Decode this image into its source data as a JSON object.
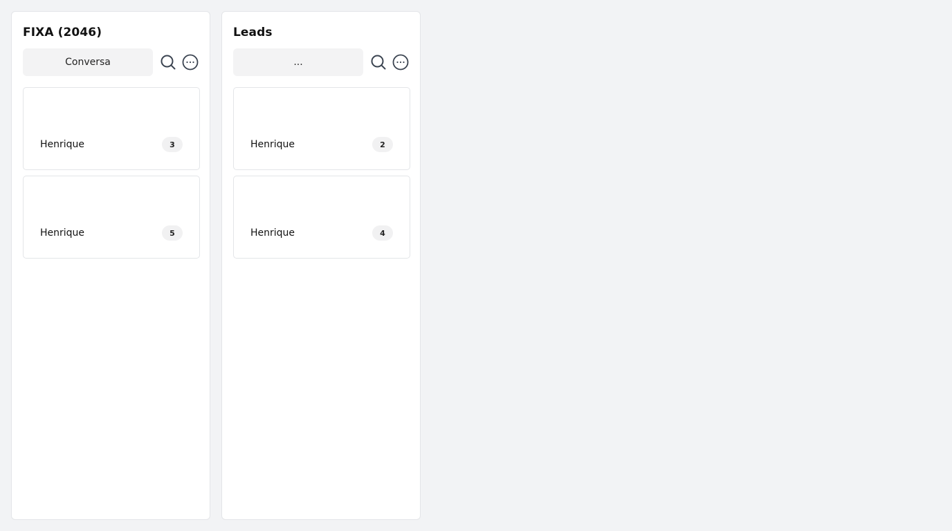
{
  "columns": [
    {
      "title": "FIXA (2046)",
      "filter_label": "Conversa",
      "cards": [
        {
          "name": "Henrique",
          "count": "3"
        },
        {
          "name": "Henrique",
          "count": "5"
        }
      ]
    },
    {
      "title": "Leads",
      "filter_label": "...",
      "cards": [
        {
          "name": "Henrique",
          "count": "2"
        },
        {
          "name": "Henrique",
          "count": "4"
        }
      ]
    }
  ],
  "icons": {
    "search": "search-icon",
    "more": "more-options-icon"
  },
  "colors": {
    "page_background": "#f2f3f5",
    "panel_background": "#ffffff",
    "control_background": "#f3f3f4",
    "icon_stroke": "#3a4350"
  }
}
